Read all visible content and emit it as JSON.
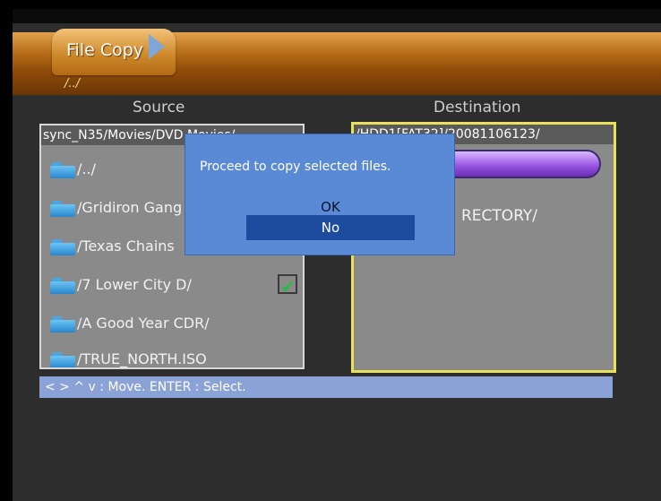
{
  "header": {
    "title": "File Copy",
    "current_path": "/../"
  },
  "source": {
    "heading": "Source",
    "path": "sync_N35/Movies/DVD Movies/",
    "items": [
      {
        "label": "/../",
        "checked": false
      },
      {
        "label": "/Gridiron Gang",
        "checked": false
      },
      {
        "label": "/Texas Chains",
        "checked": false
      },
      {
        "label": "/7 Lower City D/",
        "checked": true
      },
      {
        "label": "/A Good Year CDR/",
        "checked": false
      },
      {
        "label": "/TRUE_NORTH.ISO",
        "checked": false
      }
    ]
  },
  "destination": {
    "heading": "Destination",
    "path": "/HDD1[FAT32]/20081106123/",
    "dir_label": "RECTORY/"
  },
  "help": "< > ^ v : Move. ENTER : Select.",
  "dialog": {
    "message": "Proceed to copy selected files.",
    "ok": "OK",
    "no": "No"
  },
  "colors": {
    "header": "#b76d18",
    "dialog": "#5a8ad6",
    "dialog_selected": "#1d4b9e",
    "dest_border": "#e7e15d",
    "help_bar": "#8aa2d6"
  }
}
